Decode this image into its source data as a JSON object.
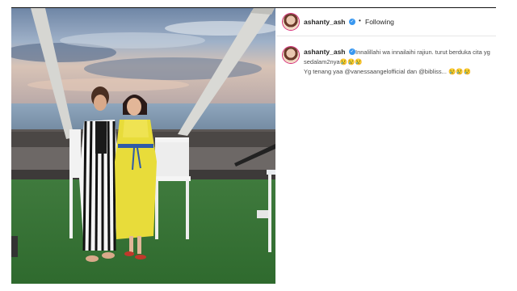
{
  "post": {
    "photo_alt": "",
    "header": {
      "username": "ashanty_ash",
      "separator": "•",
      "follow_label": "Following",
      "verified_mark": "✓"
    },
    "caption": {
      "username": "ashanty_ash",
      "verified_mark": "✓",
      "line1": "Innalillahi wa innailaihi rajiun. turut berduka cita yg sedalam2nya😢😢😢",
      "line2_prefix": "Yg tenang yaa ",
      "mention1": "@vanessaangelofficial",
      "line2_mid": " dan ",
      "mention2": "@bibliss",
      "line2_suffix": "... 😢😢😢"
    },
    "colors": {
      "verified": "#3897f0",
      "text": "#262626",
      "border": "#e6e6e6"
    }
  }
}
